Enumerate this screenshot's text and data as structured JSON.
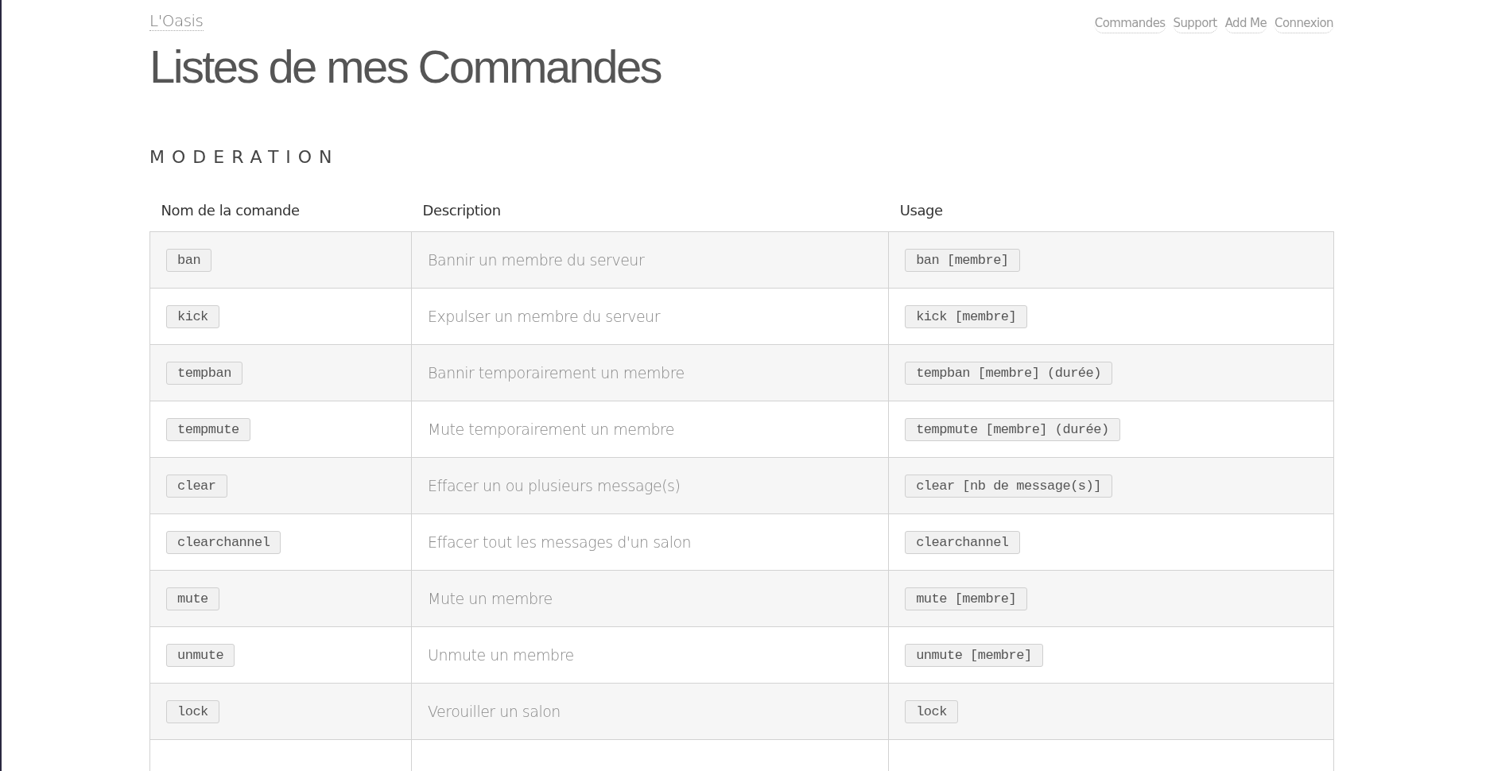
{
  "site_name": "L'Oasis",
  "nav": [
    "Commandes",
    "Support",
    "Add Me",
    "Connexion"
  ],
  "title": "Listes de mes Commandes",
  "section": "MODERATION",
  "table": {
    "columns": [
      "Nom de la comande",
      "Description",
      "Usage"
    ],
    "rows": [
      {
        "command": "ban",
        "description": "Bannir un membre du serveur",
        "usage": "ban [membre]"
      },
      {
        "command": "kick",
        "description": "Expulser un membre du serveur",
        "usage": "kick [membre]"
      },
      {
        "command": "tempban",
        "description": "Bannir temporairement un membre",
        "usage": "tempban [membre] (durée)"
      },
      {
        "command": "tempmute",
        "description": "Mute temporairement un membre",
        "usage": "tempmute [membre] (durée)"
      },
      {
        "command": "clear",
        "description": "Effacer un ou plusieurs message(s)",
        "usage": "clear [nb de message(s)]"
      },
      {
        "command": "clearchannel",
        "description": "Effacer tout les messages d'un salon",
        "usage": "clearchannel"
      },
      {
        "command": "mute",
        "description": "Mute un membre",
        "usage": "mute [membre]"
      },
      {
        "command": "unmute",
        "description": "Unmute un membre",
        "usage": "unmute [membre]"
      },
      {
        "command": "lock",
        "description": "Verouiller un salon",
        "usage": "lock"
      }
    ]
  }
}
